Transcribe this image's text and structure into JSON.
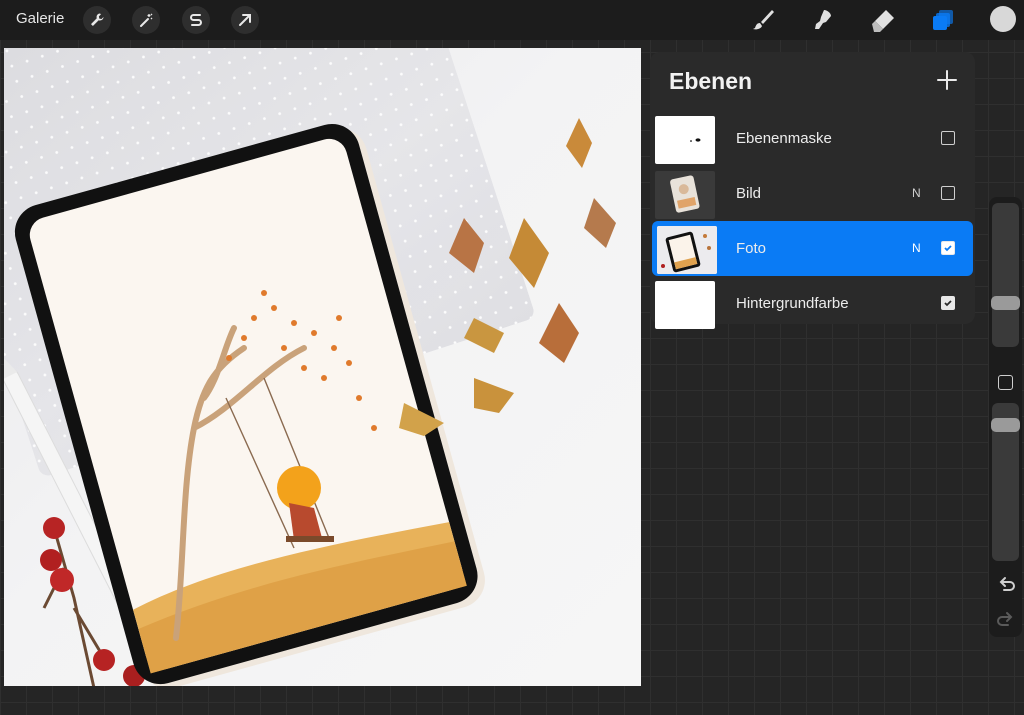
{
  "topbar": {
    "gallery_label": "Galerie",
    "left_tools": [
      "wrench-icon",
      "magic-wand-icon",
      "selection-s-icon",
      "arrow-icon"
    ],
    "right_tools": [
      "brush-icon",
      "smudge-icon",
      "eraser-icon",
      "layers-icon"
    ],
    "active_tool": "layers-icon",
    "accent_color": "#0a7bf5",
    "current_color": "#d8d8d8"
  },
  "layers_panel": {
    "title": "Ebenen",
    "add_icon": "plus-icon",
    "layers": [
      {
        "name": "Ebenenmaske",
        "blend": "",
        "visible": false,
        "selected": false
      },
      {
        "name": "Bild",
        "blend": "N",
        "visible": false,
        "selected": false
      },
      {
        "name": "Foto",
        "blend": "N",
        "visible": true,
        "selected": true
      },
      {
        "name": "Hintergrundfarbe",
        "blend": "",
        "visible": true,
        "selected": false
      }
    ]
  },
  "sidebar": {
    "brush_size_icon": "size-slider",
    "modify_icon": "modify-square-icon",
    "opacity_icon": "opacity-slider",
    "undo_icon": "undo-icon",
    "redo_icon": "redo-icon"
  }
}
